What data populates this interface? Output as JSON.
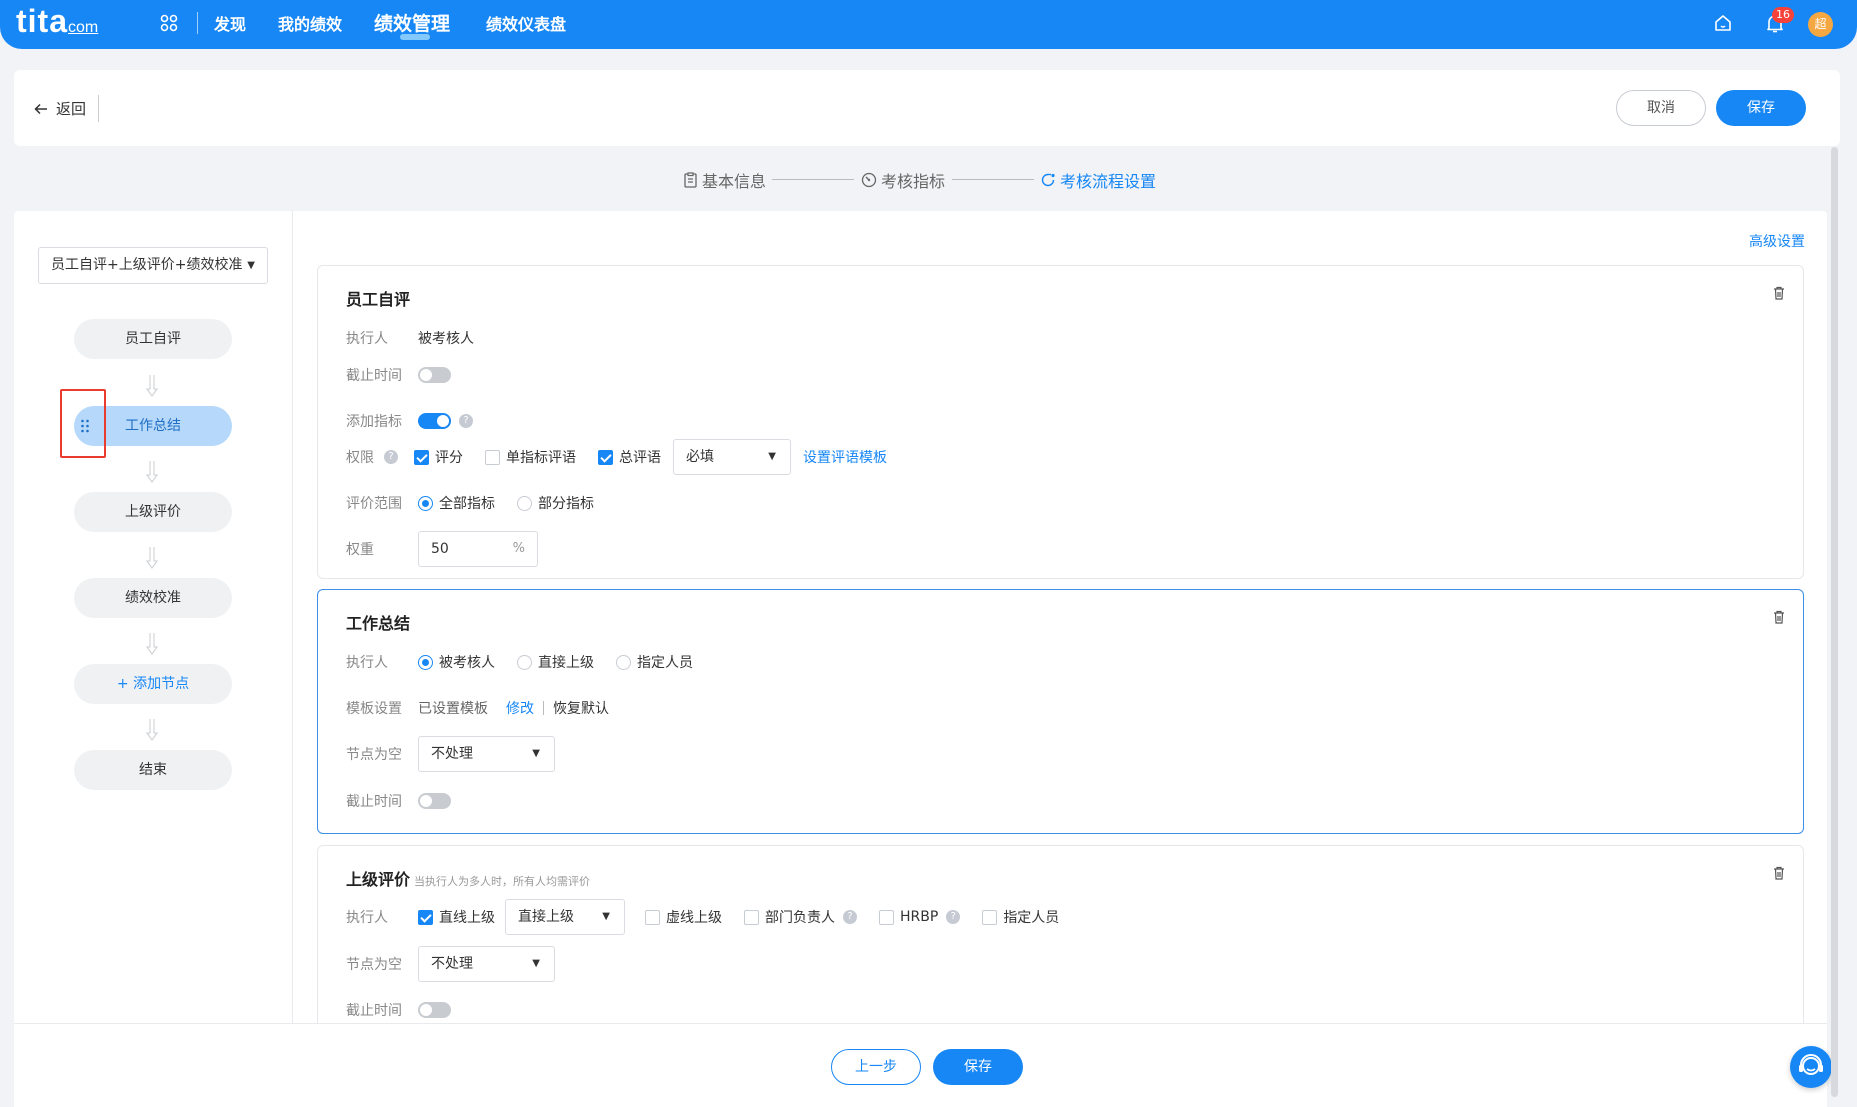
{
  "header": {
    "logo_main": "tita",
    "logo_sub": "com",
    "nav": [
      {
        "label": "发现"
      },
      {
        "label": "我的绩效"
      },
      {
        "label": "绩效管理"
      },
      {
        "label": "绩效仪表盘"
      }
    ],
    "active_nav": "绩效管理",
    "notification_count": "16",
    "avatar_text": "超",
    "icons": [
      "apps-icon",
      "home-icon",
      "bell-icon"
    ],
    "colors": {
      "brand": "#1687f5",
      "badge": "#f5433c",
      "avatar": "#f5a742"
    }
  },
  "subheader": {
    "back_label": "返回",
    "cancel_label": "取消",
    "save_label": "保存"
  },
  "steps": [
    {
      "label": "基本信息",
      "icon": "document-icon"
    },
    {
      "label": "考核指标",
      "icon": "gauge-icon"
    },
    {
      "label": "考核流程设置",
      "icon": "flow-icon"
    }
  ],
  "active_step": "考核流程设置",
  "sidebar": {
    "template": "员工自评+上级评价+绩效校准",
    "nodes": [
      {
        "label": "员工自评"
      },
      {
        "label": "工作总结"
      },
      {
        "label": "上级评价"
      },
      {
        "label": "绩效校准"
      },
      {
        "label": "+ 添加节点"
      },
      {
        "label": "结束"
      }
    ],
    "active_node": "工作总结"
  },
  "advanced_link": "高级设置",
  "cards": {
    "self": {
      "title": "员工自评",
      "executor_label": "执行人",
      "executor_value": "被考核人",
      "deadline_label": "截止时间",
      "deadline_enabled": false,
      "add_metric_label": "添加指标",
      "add_metric_enabled": true,
      "perm_label": "权限",
      "perm_options": [
        {
          "label": "评分",
          "checked": true
        },
        {
          "label": "单指标评语",
          "checked": false
        },
        {
          "label": "总评语",
          "checked": true
        }
      ],
      "perm_select": "必填",
      "perm_link": "设置评语模板",
      "scope_label": "评价范围",
      "scope_options": [
        {
          "label": "全部指标",
          "checked": true
        },
        {
          "label": "部分指标",
          "checked": false
        }
      ],
      "weight_label": "权重",
      "weight_value": "50",
      "weight_unit": "%"
    },
    "summary": {
      "title": "工作总结",
      "executor_label": "执行人",
      "executor_options": [
        {
          "label": "被考核人",
          "checked": true
        },
        {
          "label": "直接上级",
          "checked": false
        },
        {
          "label": "指定人员",
          "checked": false
        }
      ],
      "template_label": "模板设置",
      "template_value": "已设置模板",
      "template_edit": "修改",
      "template_reset": "恢复默认",
      "empty_label": "节点为空",
      "empty_select": "不处理",
      "deadline_label": "截止时间",
      "deadline_enabled": false
    },
    "superior": {
      "title": "上级评价",
      "note": "当执行人为多人时，所有人均需评价",
      "executor_label": "执行人",
      "direct_label": "直线上级",
      "direct_checked": true,
      "direct_select": "直接上级",
      "other_options": [
        {
          "label": "虚线上级",
          "checked": false
        },
        {
          "label": "部门负责人",
          "checked": false,
          "help": true
        },
        {
          "label": "HRBP",
          "checked": false,
          "help": true
        },
        {
          "label": "指定人员",
          "checked": false
        }
      ],
      "empty_label": "节点为空",
      "empty_select": "不处理",
      "deadline_label": "截止时间",
      "deadline_enabled": false
    }
  },
  "footer": {
    "prev_label": "上一步",
    "save_label": "保存"
  }
}
